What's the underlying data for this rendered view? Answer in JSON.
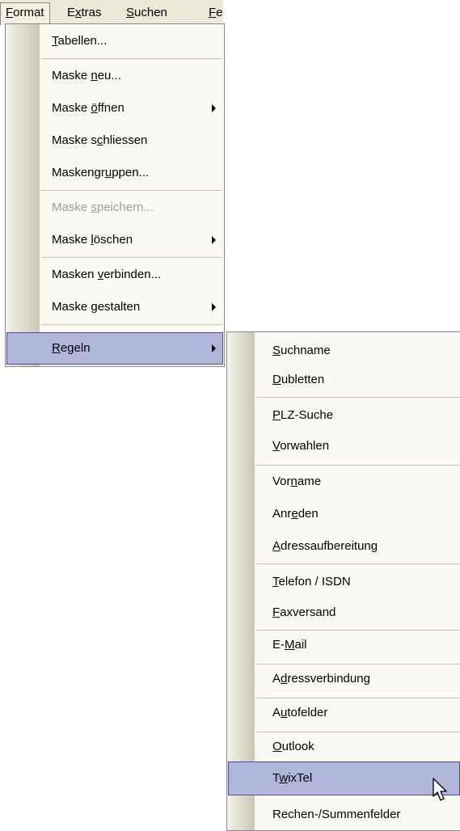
{
  "menubar": {
    "items": [
      {
        "label": "Format",
        "u": "F",
        "rest": "ormat"
      },
      {
        "label": "Extras",
        "pre": "E",
        "u": "x",
        "rest": "tras"
      },
      {
        "label": "Suchen",
        "u": "S",
        "rest": "uchen"
      },
      {
        "label": "Fe",
        "u": "F",
        "rest": "e"
      }
    ]
  },
  "format_menu": {
    "items": [
      {
        "u": "T",
        "rest": "abellen..."
      },
      {
        "pre": "Maske ",
        "u": "n",
        "rest": "eu..."
      },
      {
        "pre": "Maske ",
        "u": "ö",
        "rest": "ffnen"
      },
      {
        "pre": "Maske s",
        "u": "c",
        "rest": "hliessen"
      },
      {
        "pre": "Maskengr",
        "u": "u",
        "rest": "ppen..."
      },
      {
        "pre": "Maske ",
        "u": "s",
        "rest": "peichern..."
      },
      {
        "pre": "Maske ",
        "u": "l",
        "rest": "öschen"
      },
      {
        "pre": "Masken ",
        "u": "v",
        "rest": "erbinden..."
      },
      {
        "pre": "Maske ",
        "u": "g",
        "rest": "estalten"
      },
      {
        "u": "R",
        "rest": "egeln"
      }
    ]
  },
  "regeln_menu": {
    "items": [
      {
        "u": "S",
        "rest": "uchname"
      },
      {
        "u": "D",
        "rest": "ubletten"
      },
      {
        "u": "P",
        "rest": "LZ-Suche"
      },
      {
        "u": "V",
        "rest": "orwahlen"
      },
      {
        "pre": "Vor",
        "u": "n",
        "rest": "ame"
      },
      {
        "pre": "Anr",
        "u": "e",
        "rest": "den"
      },
      {
        "u": "A",
        "rest": "dressaufbereitung"
      },
      {
        "u": "T",
        "rest": "elefon / ISDN"
      },
      {
        "u": "F",
        "rest": "axversand"
      },
      {
        "pre": "E-",
        "u": "M",
        "rest": "ail"
      },
      {
        "pre": "A",
        "u": "d",
        "rest": "ressverbindung"
      },
      {
        "pre": "A",
        "u": "u",
        "rest": "tofelder"
      },
      {
        "u": "O",
        "rest": "utlook"
      },
      {
        "pre": "T",
        "u": "w",
        "rest": "ixTel"
      },
      {
        "pre": "Rechen-/Summenfelder",
        "u": "",
        "rest": ""
      }
    ]
  },
  "icons": {
    "submenu_arrow": "chevron-right-icon",
    "cursor": "mouse-pointer-icon"
  },
  "colors": {
    "menu_bg": "#fbfaf4",
    "highlight": "#b1b6dc",
    "highlight_border": "#4b4f8f",
    "menubar_bg": "#ECE9D8"
  }
}
